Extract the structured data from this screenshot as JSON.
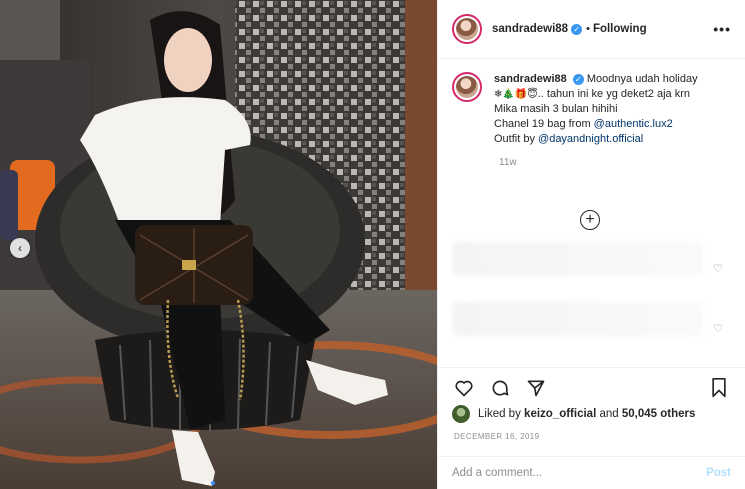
{
  "post": {
    "username": "sandradewi88",
    "verified_icon": "verified-badge-icon",
    "follow_status": "Following",
    "bullet": "•",
    "more": "•••"
  },
  "caption": {
    "username": "sandradewi88",
    "line1": "Moodnya udah holiday",
    "emojis": "❄🎄🎁😇",
    "line1_rest": ".. tahun ini ke yg deket2 aja krn Mika masih 3 bulan hihihi",
    "line2_prefix": "Chanel 19 bag from ",
    "line2_mention": "@authentic.lux2",
    "line3_prefix": "Outfit by ",
    "line3_mention": "@dayandnight.official",
    "time": "11w"
  },
  "load_more_icon": "plus-circle-icon",
  "actions": {
    "like_icon": "heart-icon",
    "comment_icon": "comment-icon",
    "share_icon": "share-icon",
    "save_icon": "bookmark-icon"
  },
  "likes": {
    "prefix": "Liked by ",
    "user": "keizo_official",
    "middle": " and ",
    "count": "50,045 others"
  },
  "date": "DECEMBER 16, 2019",
  "comment_input": {
    "placeholder": "Add a comment...",
    "post_label": "Post"
  },
  "colors": {
    "link": "#003569",
    "verified": "#3897f0",
    "post_disabled": "#b2dffc",
    "story_ring": "#d6296b"
  }
}
